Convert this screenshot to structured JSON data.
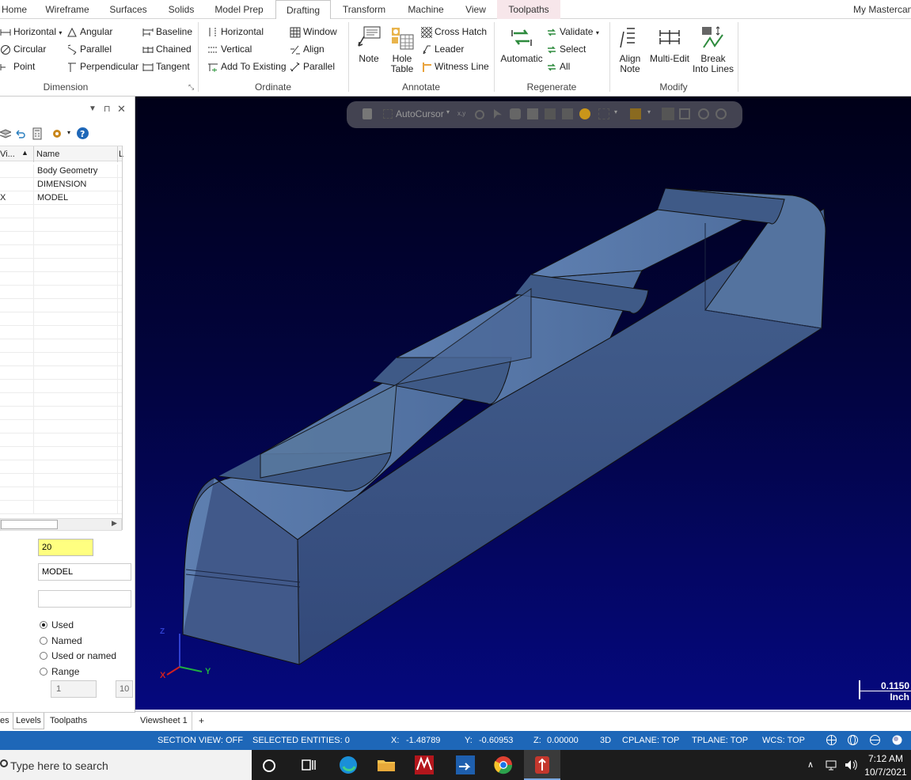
{
  "ribbon_tabs": [
    {
      "label": "Home"
    },
    {
      "label": "Wireframe"
    },
    {
      "label": "Surfaces"
    },
    {
      "label": "Solids"
    },
    {
      "label": "Model Prep"
    },
    {
      "label": "Drafting"
    },
    {
      "label": "Transform"
    },
    {
      "label": "Machine"
    },
    {
      "label": "View"
    },
    {
      "label": "Toolpaths"
    }
  ],
  "account_label": "My Mastercam",
  "dimension": {
    "group_label": "Dimension",
    "horizontal": "Horizontal",
    "angular": "Angular",
    "baseline": "Baseline",
    "circular": "Circular",
    "parallel": "Parallel",
    "chained": "Chained",
    "point": "Point",
    "perpendicular": "Perpendicular",
    "tangent": "Tangent"
  },
  "ordinate": {
    "group_label": "Ordinate",
    "horizontal": "Horizontal",
    "window": "Window",
    "vertical": "Vertical",
    "align": "Align",
    "add_to_existing": "Add To Existing",
    "parallel": "Parallel"
  },
  "annotate": {
    "group_label": "Annotate",
    "note": "Note",
    "hole_table_1": "Hole",
    "hole_table_2": "Table",
    "cross_hatch": "Cross Hatch",
    "leader": "Leader",
    "witness_line": "Witness Line"
  },
  "regenerate": {
    "group_label": "Regenerate",
    "automatic": "Automatic",
    "validate": "Validate",
    "select": "Select",
    "all": "All"
  },
  "modify": {
    "group_label": "Modify",
    "align_note_1": "Align",
    "align_note_2": "Note",
    "multi_edit": "Multi-Edit",
    "break_1": "Break",
    "break_2": "Into Lines"
  },
  "levels_panel": {
    "col_visible": "Vi...",
    "col_name": "Name",
    "col_extra": "L",
    "rows": [
      {
        "mark": "",
        "name": "Body Geometry"
      },
      {
        "mark": "",
        "name": "DIMENSION"
      },
      {
        "mark": "X",
        "name": "MODEL"
      }
    ],
    "number_value": "20",
    "name_value": "MODEL",
    "level_set_value": "",
    "radio_used": "Used",
    "radio_named": "Named",
    "radio_used_or_named": "Used or named",
    "radio_range": "Range",
    "range_from": "1",
    "range_to": "10",
    "bottom_tabs": [
      {
        "label": "es"
      },
      {
        "label": "Levels"
      },
      {
        "label": "Toolpaths"
      }
    ]
  },
  "viewport": {
    "autocursor_label": "AutoCursor",
    "scale_value": "0.1150",
    "scale_unit": "Inch",
    "axis_x": "X",
    "axis_y": "Y",
    "axis_z": "Z"
  },
  "sheetbar": {
    "sheet": "Viewsheet 1",
    "add": "+"
  },
  "statusbar": {
    "section_view": "SECTION VIEW: OFF",
    "selected": "SELECTED ENTITIES: 0",
    "x_label": "X:",
    "x_value": "-1.48789",
    "y_label": "Y:",
    "y_value": "-0.60953",
    "z_label": "Z:",
    "z_value": "0.00000",
    "mode": "3D",
    "cplane": "CPLANE: TOP",
    "tplane": "TPLANE: TOP",
    "wcs": "WCS: TOP"
  },
  "taskbar": {
    "search_placeholder": "Type here to search",
    "time": "7:12 AM",
    "date": "10/7/2021"
  },
  "colors": {
    "status_blue": "#1e67b8",
    "part_top": "#5a7aa8",
    "part_side": "#3e5a86",
    "viewport_bottom": "#05087e"
  }
}
